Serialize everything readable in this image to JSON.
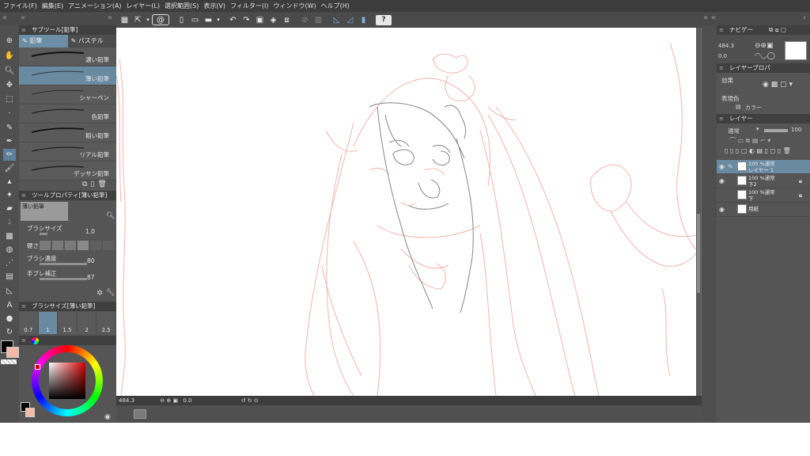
{
  "menubar": {
    "items": [
      "ファイル(F)",
      "編集(E)",
      "アニメーション(A)",
      "レイヤー(L)",
      "選択範囲(S)",
      "表示(V)",
      "フィルター(I)",
      "ウィンドウ(W)",
      "ヘルプ(H)"
    ]
  },
  "left_panel": {
    "subtool_title": "サブツール[鉛筆]",
    "tabs": [
      "鉛筆",
      "パステル"
    ],
    "brushes": [
      "濃い鉛筆",
      "薄い鉛筆",
      "シャーペン",
      "色鉛筆",
      "粗い鉛筆",
      "リアル鉛筆",
      "デッサン鉛筆"
    ],
    "active_brush_index": 1,
    "tool_property_title": "ツールプロパティ[薄い鉛筆]",
    "preview_label": "薄い鉛筆",
    "props": {
      "brush_size_label": "ブラシサイズ",
      "brush_size_value": "1.0",
      "hardness_label": "硬さ",
      "brush_density_label": "ブラシ濃度",
      "brush_density_value": "80",
      "stabilization_label": "手ブレ補正",
      "stabilization_value": "87"
    },
    "brushsize_title": "ブラシサイズ[薄い鉛筆]",
    "sizes": [
      "0.7",
      "1",
      "1.5",
      "2",
      "2.5"
    ],
    "active_size_index": 1,
    "colors": {
      "main": "#000000",
      "sub": "#f4b9a8",
      "accent": "#6a8aa2"
    }
  },
  "status": {
    "zoom": "484.3",
    "rotation": "0.0"
  },
  "right_panel": {
    "navigator_title": "ナビゲー",
    "navigator_zoom": "484.3",
    "navigator_angle": "0.0",
    "layer_property_title": "レイヤープロパ",
    "effect_label": "効果",
    "expression_color_label": "表現色",
    "expression_color_value": "カラー",
    "layer_title": "レイヤー",
    "blend_mode": "通常",
    "opacity": "100",
    "layers": [
      {
        "line1": "100 %通常",
        "line2": "レイヤー 1",
        "visible": true,
        "active": true
      },
      {
        "line1": "100 %通常",
        "line2": "下2",
        "visible": true,
        "active": false
      },
      {
        "line1": "100 %通常",
        "line2": "下",
        "visible": false,
        "active": false
      },
      {
        "line1": "",
        "line2": "用紙",
        "visible": true,
        "active": false
      }
    ]
  }
}
